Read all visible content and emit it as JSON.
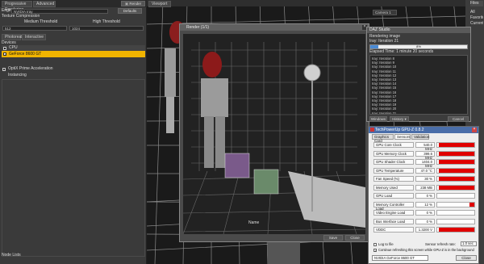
{
  "left_panel": {
    "tabs": [
      "Progressive Rendering",
      "Advanced"
    ],
    "render_button": "Render",
    "engine_label": "Engine",
    "engine_value": "NVIDIA Iray",
    "defaults_button": "Defaults",
    "texture_compression": "Texture Compression",
    "medium_threshold": "Medium Threshold",
    "high_threshold": "High Threshold",
    "medium_value": "512",
    "high_value": "1024",
    "subtabs": [
      "Photoreal",
      "Interactive"
    ],
    "devices_label": "Devices",
    "cpu_device": "CPU",
    "gpu_device": "GeForce 8600 GT",
    "optix_label": "OptiX Prime Acceleration",
    "instancing_label": "Instancing",
    "bottom_label": "Node Lists"
  },
  "viewport": {
    "tab": "Viewport",
    "camera": "Camera 1"
  },
  "right_panel": {
    "header": "Files",
    "items": [
      "All",
      "Favorites",
      "Currently Used"
    ]
  },
  "render_window": {
    "title": "Render (1/1)",
    "name_label": "Name",
    "save_button": "Save",
    "close_button": "Close"
  },
  "daz_window": {
    "title": "DAZ Studio",
    "status": "Rendering image",
    "iteration": "Iray: Iteration 21",
    "percent": "8%",
    "elapsed": "Elapsed Time: 1 minute 20 seconds",
    "log": [
      "Iray: Iteration 8",
      "Iray: Iteration 9",
      "Iray: Iteration 10",
      "Iray: Iteration 11",
      "Iray: Iteration 12",
      "Iray: Iteration 13",
      "Iray: Iteration 14",
      "Iray: Iteration 15",
      "Iray: Iteration 16",
      "Iray: Iteration 17",
      "Iray: Iteration 18",
      "Iray: Iteration 19",
      "Iray: Iteration 20",
      "Iray: Iteration 21"
    ],
    "windows_button": "Windows",
    "history_button": "History",
    "cancel_button": "Cancel",
    "progress_fraction": 0.08
  },
  "gpuz": {
    "title": "TechPowerUp GPU-Z 0.8.2",
    "tabs": [
      "Graphics Card",
      "Sensors",
      "Validation"
    ],
    "sensors": [
      {
        "label": "GPU Core Clock",
        "value": "540.0 MHz",
        "level": 0.95
      },
      {
        "label": "GPU Memory Clock",
        "value": "399.6 MHz",
        "level": 0.95
      },
      {
        "label": "GPU Shader Clock",
        "value": "1404.0 MHz",
        "level": 0.95
      },
      {
        "label": "GPU Temperature",
        "value": "47.0 °C",
        "level": 0.95
      },
      {
        "label": "Fan Speed (%)",
        "value": "30 %",
        "level": 0.95
      },
      {
        "label": "Memory Used",
        "value": "238 MB",
        "level": 0.95
      },
      {
        "label": "GPU Load",
        "value": "0 %",
        "level": 0.0
      },
      {
        "label": "Memory Controller Load",
        "value": "12 %",
        "level": 0.12
      },
      {
        "label": "Video Engine Load",
        "value": "0 %",
        "level": 0.0
      },
      {
        "label": "Bus Interface Load",
        "value": "0 %",
        "level": 0.0
      },
      {
        "label": "VDDC",
        "value": "1.3200 V",
        "level": 0.95
      }
    ],
    "log_to_file": "Log to file",
    "refresh_label": "Sensor refresh rate:",
    "refresh_value": "1.0 sec",
    "continue_label": "Continue refreshing this screen while GPU-Z is in the background",
    "card_select": "NVIDIA GeForce 8600 GT",
    "close_button": "Close"
  }
}
